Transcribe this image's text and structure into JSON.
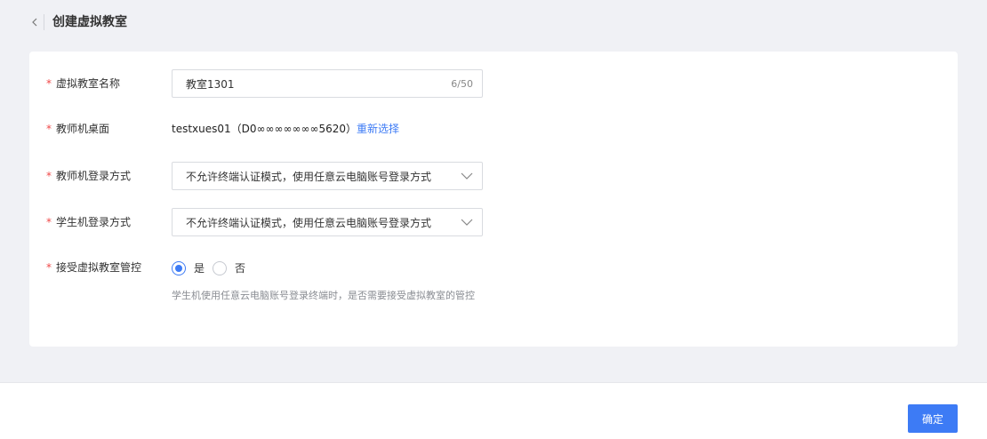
{
  "header": {
    "title": "创建虚拟教室",
    "back_icon": "chevron-left-icon"
  },
  "form": {
    "classroom_name": {
      "label": "虚拟教室名称",
      "value": "教室1301",
      "counter": "6/50"
    },
    "teacher_desktop": {
      "label": "教师机桌面",
      "value": "testxues01（D0∞∞∞∞∞∞∞5620）",
      "reselect_link": "重新选择"
    },
    "teacher_login": {
      "label": "教师机登录方式",
      "value": "不允许终端认证模式，使用任意云电脑账号登录方式"
    },
    "student_login": {
      "label": "学生机登录方式",
      "value": "不允许终端认证模式，使用任意云电脑账号登录方式"
    },
    "accept_control": {
      "label": "接受虚拟教室管控",
      "options": [
        "是",
        "否"
      ],
      "selected": "是",
      "hint": "学生机使用任意云电脑账号登录终端时，是否需要接受虚拟教室的管控"
    },
    "required_mark": "*"
  },
  "footer": {
    "confirm_label": "确定"
  },
  "colors": {
    "accent": "#3d7bf5",
    "required": "#f04848",
    "page_bg": "#f0f1f5"
  }
}
